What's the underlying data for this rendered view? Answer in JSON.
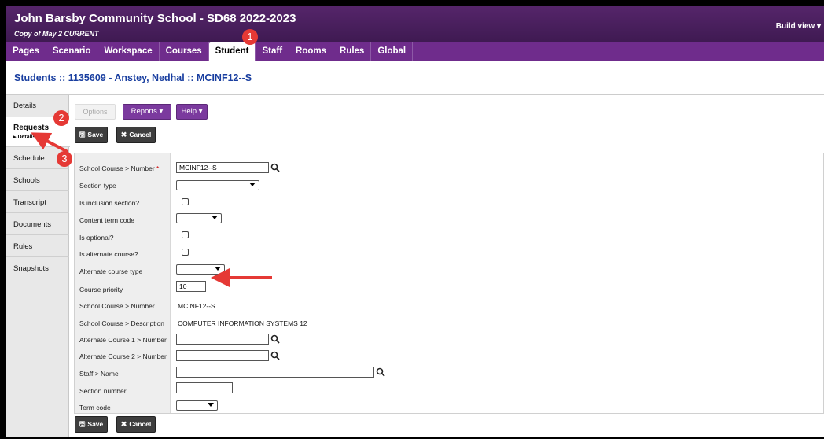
{
  "header": {
    "title": "John Barsby Community School - SD68 2022-2023",
    "subtitle": "Copy of May 2 CURRENT",
    "build_view": "Build view ▾"
  },
  "nav": {
    "tabs": [
      "Pages",
      "Scenario",
      "Workspace",
      "Courses",
      "Student",
      "Staff",
      "Rooms",
      "Rules",
      "Global"
    ],
    "active": "Student"
  },
  "breadcrumb": "Students :: 1135609 - Anstey, Nedhal :: MCINF12--S",
  "sidebar": {
    "items": [
      "Details",
      "Requests",
      "Schedule",
      "Schools",
      "Transcript",
      "Documents",
      "Rules",
      "Snapshots"
    ],
    "sub_label": "▸ Details"
  },
  "toolbar": {
    "options": "Options",
    "reports": "Reports ▾",
    "help": "Help ▾",
    "save": "Save",
    "cancel": "Cancel"
  },
  "form": {
    "labels": {
      "school_course_number": "School Course > Number",
      "required_mark": "*",
      "section_type": "Section type",
      "is_inclusion": "Is inclusion section?",
      "content_term_code": "Content term code",
      "is_optional": "Is optional?",
      "is_alternate": "Is alternate course?",
      "alternate_course_type": "Alternate course type",
      "course_priority": "Course priority",
      "school_course_number_ro": "School Course > Number",
      "school_course_description": "School Course > Description",
      "alt_course_1": "Alternate Course 1 > Number",
      "alt_course_2": "Alternate Course 2 > Number",
      "staff_name": "Staff > Name",
      "section_number": "Section number",
      "term_code": "Term code"
    },
    "values": {
      "school_course_number": "MCINF12--S",
      "course_priority": "10",
      "school_course_number_ro": "MCINF12--S",
      "school_course_description": "COMPUTER INFORMATION SYSTEMS 12",
      "alt_course_1": "",
      "alt_course_2": "",
      "staff_name": "",
      "section_number": ""
    }
  },
  "annotations": {
    "step1": "1",
    "step2": "2",
    "step3": "3",
    "color": "#e53935"
  }
}
